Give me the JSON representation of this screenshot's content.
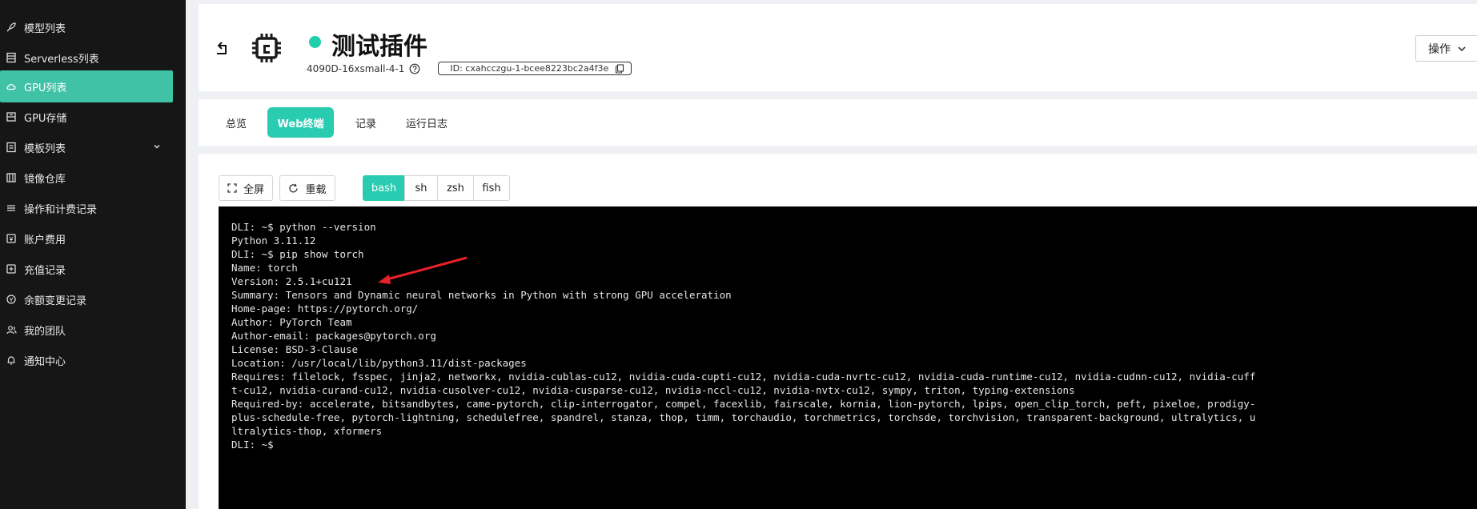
{
  "sidebar": {
    "items": [
      {
        "label": "模型列表",
        "icon": "rocket-icon"
      },
      {
        "label": "Serverless列表",
        "icon": "server-list-icon"
      },
      {
        "label": "GPU列表",
        "icon": "cloud-icon",
        "active": true
      },
      {
        "label": "GPU存储",
        "icon": "storage-icon"
      },
      {
        "label": "模板列表",
        "icon": "template-icon",
        "expandable": true
      },
      {
        "label": "镜像仓库",
        "icon": "image-repo-icon"
      },
      {
        "label": "操作和计费记录",
        "icon": "billing-record-icon"
      },
      {
        "label": "账户费用",
        "icon": "account-fee-icon"
      },
      {
        "label": "充值记录",
        "icon": "recharge-icon"
      },
      {
        "label": "余额变更记录",
        "icon": "balance-change-icon"
      },
      {
        "label": "我的团队",
        "icon": "team-icon"
      },
      {
        "label": "通知中心",
        "icon": "bell-icon"
      }
    ]
  },
  "header": {
    "title": "测试插件",
    "instance_type": "4090D-16xsmall-4-1",
    "id_text": "ID:  cxahcczgu-1-bcee8223bc2a4f3e",
    "op_label": "操作",
    "status_color": "#1fcfac"
  },
  "tabs": [
    {
      "label": "总览"
    },
    {
      "label": "Web终端",
      "active": true
    },
    {
      "label": "记录"
    },
    {
      "label": "运行日志"
    }
  ],
  "toolbar": {
    "fullscreen_label": "全屏",
    "reconnect_label": "重载",
    "shells": [
      "bash",
      "sh",
      "zsh",
      "fish"
    ],
    "active_shell": "bash"
  },
  "terminal": {
    "lines": [
      "DLI: ~$ python --version",
      "Python 3.11.12",
      "DLI: ~$ pip show torch",
      "Name: torch",
      "Version: 2.5.1+cu121",
      "Summary: Tensors and Dynamic neural networks in Python with strong GPU acceleration",
      "Home-page: https://pytorch.org/",
      "Author: PyTorch Team",
      "Author-email: packages@pytorch.org",
      "License: BSD-3-Clause",
      "Location: /usr/local/lib/python3.11/dist-packages",
      "Requires: filelock, fsspec, jinja2, networkx, nvidia-cublas-cu12, nvidia-cuda-cupti-cu12, nvidia-cuda-nvrtc-cu12, nvidia-cuda-runtime-cu12, nvidia-cudnn-cu12, nvidia-cuff",
      "t-cu12, nvidia-curand-cu12, nvidia-cusolver-cu12, nvidia-cusparse-cu12, nvidia-nccl-cu12, nvidia-nvtx-cu12, sympy, triton, typing-extensions",
      "Required-by: accelerate, bitsandbytes, came-pytorch, clip-interrogator, compel, facexlib, fairscale, kornia, lion-pytorch, lpips, open_clip_torch, peft, pixeloe, prodigy-",
      "plus-schedule-free, pytorch-lightning, schedulefree, spandrel, stanza, thop, timm, torchaudio, torchmetrics, torchsde, torchvision, transparent-background, ultralytics, u",
      "ltralytics-thop, xformers",
      "DLI: ~$ "
    ]
  },
  "colors": {
    "accent": "#29ccb0",
    "annotation_arrow": "#e8202a"
  }
}
